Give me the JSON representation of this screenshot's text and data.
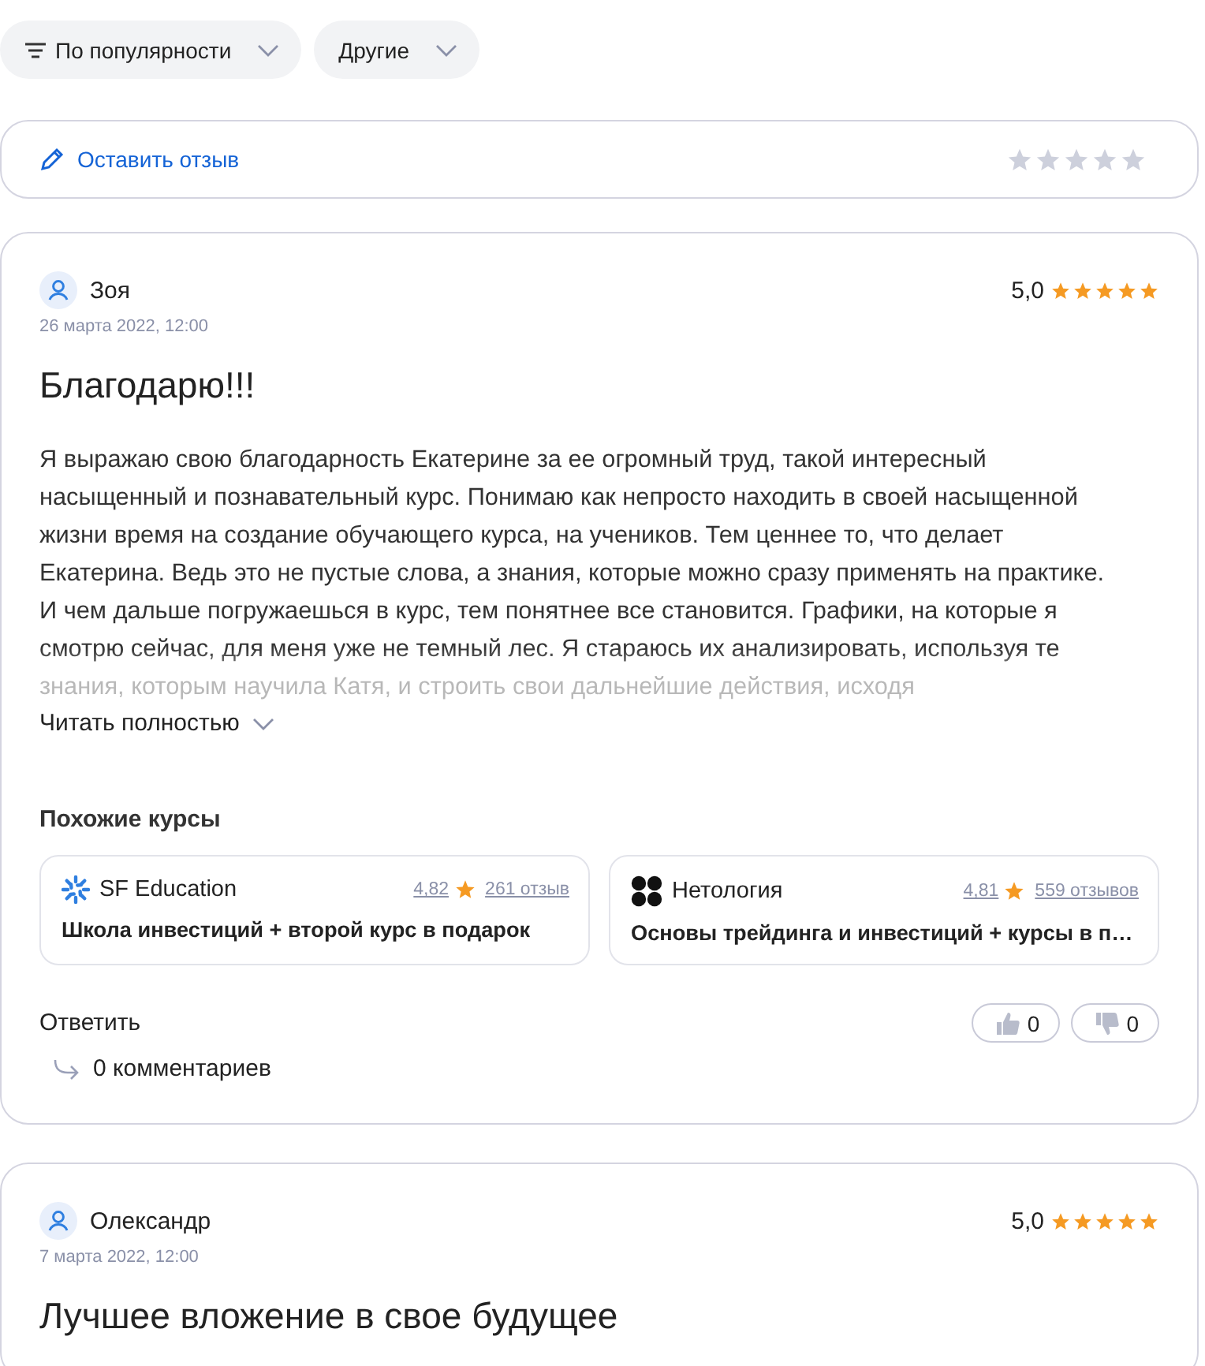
{
  "filters": [
    {
      "label": "По популярности",
      "kind": "sort"
    },
    {
      "label": "Другие",
      "kind": "plain"
    }
  ],
  "leave_review": {
    "label": "Оставить отзыв",
    "stars": 0
  },
  "reviews": [
    {
      "author": "Зоя",
      "date": "26 марта 2022, 12:00",
      "rating": "5,0",
      "stars": 5,
      "title": "Благодарю!!!",
      "text": "Я выражаю свою благодарность Екатерине за ее огромный труд, такой интересный насыщенный и познавательный курс. Понимаю как непросто находить в своей насыщенной жизни время на создание обучающего курса, на учеников. Тем ценнее то, что делает Екатерина. Ведь это не пустые слова, а знания, которые можно сразу применять на практике. И чем дальше погружаешься в курс, тем понятнее все становится. Графики, на которые я смотрю сейчас, для меня уже не темный лес. Я стараюсь их анализировать, используя те знания, которым научила Катя, и строить свои дальнейшие действия, исходя",
      "read_more": "Читать полностью",
      "similar_title": "Похожие курсы",
      "similar": [
        {
          "school": "SF Education",
          "kind": "sf",
          "rating": "4,82",
          "reviews": "261 отзыв",
          "course": "Школа инвестиций + второй курс в подарок"
        },
        {
          "school": "Нетология",
          "kind": "netology",
          "rating": "4,81",
          "reviews": "559 отзывов",
          "course": "Основы трейдинга и инвестиций + курсы в п…"
        }
      ],
      "reply": "Ответить",
      "likes": "0",
      "dislikes": "0",
      "comments": "0 комментариев"
    },
    {
      "author": "Олександр",
      "date": "7 марта 2022, 12:00",
      "rating": "5,0",
      "stars": 5,
      "title": "Лучшее вложение в свое будущее"
    }
  ]
}
